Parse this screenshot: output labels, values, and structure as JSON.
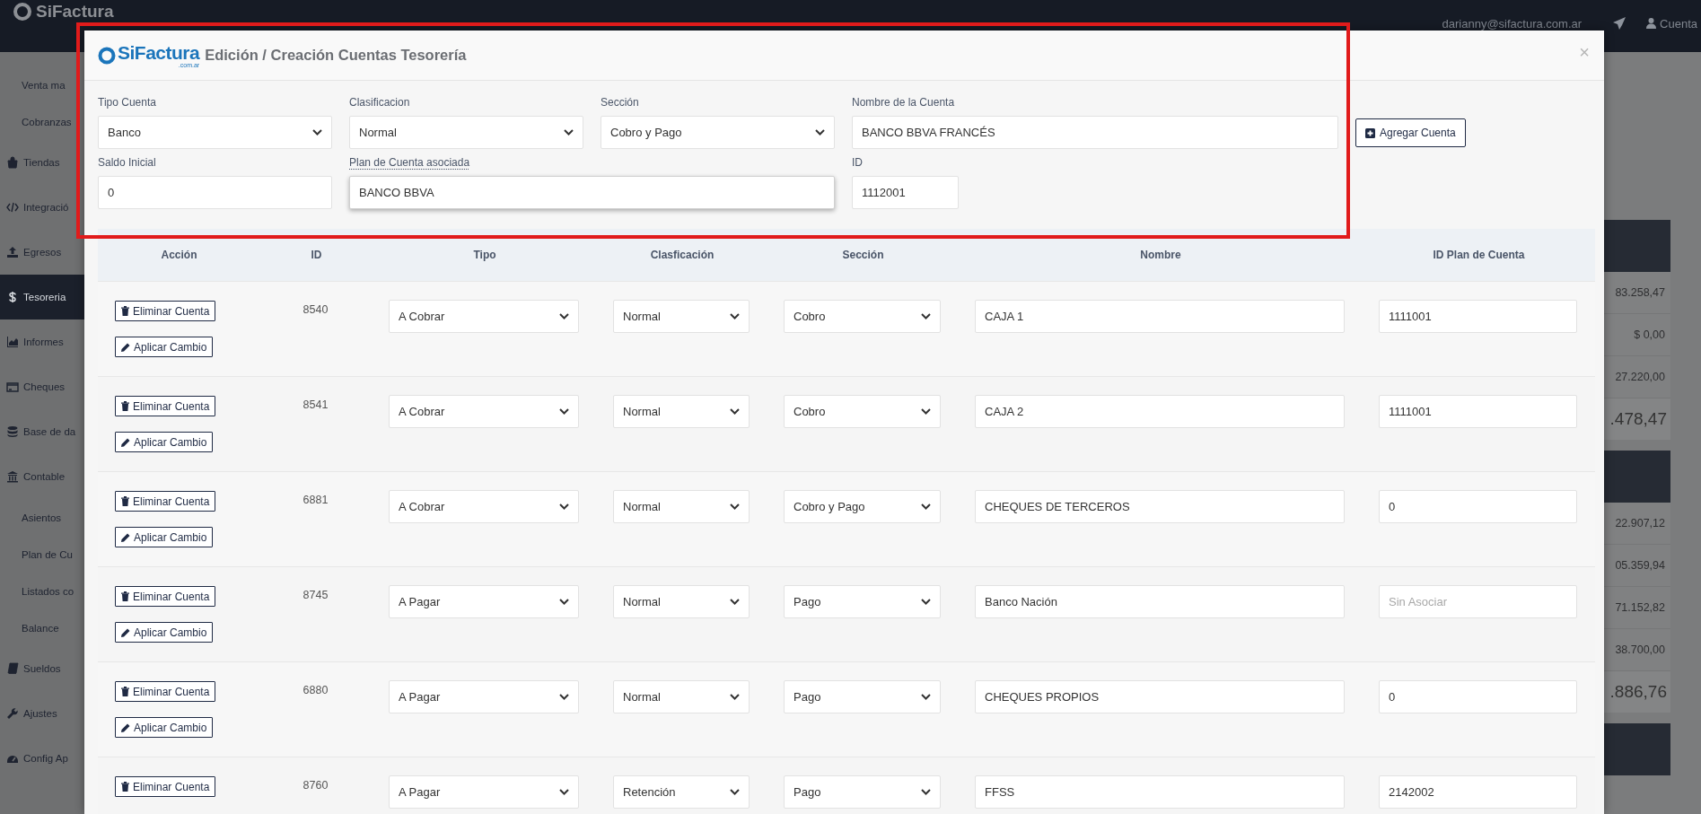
{
  "top_bar": {
    "logo": "SiFactura",
    "user_email": "darianny@sifactura.com.ar",
    "account_label": "Cuenta"
  },
  "sidebar": {
    "items": [
      {
        "kind": "subitem",
        "label": "Venta ma",
        "selected": false
      },
      {
        "kind": "subitem",
        "label": "Cobranzas",
        "selected": false
      },
      {
        "kind": "section",
        "label": "Tiendas",
        "selected": false
      },
      {
        "kind": "section",
        "label": "Integració",
        "selected": false
      },
      {
        "kind": "section",
        "label": "Egresos",
        "selected": false
      },
      {
        "kind": "section",
        "label": "Tesoreria",
        "selected": true
      },
      {
        "kind": "section",
        "label": "Informes",
        "selected": false
      },
      {
        "kind": "section",
        "label": "Cheques",
        "selected": false
      },
      {
        "kind": "section",
        "label": "Base de da",
        "selected": false
      },
      {
        "kind": "section",
        "label": "Contable",
        "selected": false
      },
      {
        "kind": "subitem",
        "label": "Asientos",
        "selected": false
      },
      {
        "kind": "subitem",
        "label": "Plan de Cu",
        "selected": false
      },
      {
        "kind": "subitem",
        "label": "Listados co",
        "selected": false
      },
      {
        "kind": "subitem",
        "label": "Balance",
        "selected": false
      },
      {
        "kind": "section",
        "label": "Sueldos",
        "selected": false
      },
      {
        "kind": "section",
        "label": "Ajustes",
        "selected": false
      },
      {
        "kind": "section",
        "label": "Config Ap",
        "selected": false
      }
    ]
  },
  "background_panel": {
    "items": [
      {
        "kind": "header"
      },
      {
        "kind": "amount",
        "text": "83.258,47"
      },
      {
        "kind": "amount",
        "text": "$ 0,00"
      },
      {
        "kind": "amount",
        "text": "27.220,00"
      },
      {
        "kind": "total",
        "text": ".478,47"
      },
      {
        "kind": "header"
      },
      {
        "kind": "amount",
        "text": "22.907,12"
      },
      {
        "kind": "amount",
        "text": "05.359,94"
      },
      {
        "kind": "amount",
        "text": "71.152,82"
      },
      {
        "kind": "amount",
        "text": "38.700,00"
      },
      {
        "kind": "total",
        "text": ".886,76"
      },
      {
        "kind": "header"
      }
    ]
  },
  "modal": {
    "logo": "SiFactura",
    "logo_suffix": ".com.ar",
    "title": "Edición / Creación Cuentas Tesorería",
    "close": "×",
    "form": {
      "rows": [
        [
          {
            "kind": "select",
            "label": "Tipo Cuenta",
            "value": "Banco",
            "label_dotted": false,
            "focused": false
          },
          {
            "kind": "select",
            "label": "Clasificacion",
            "value": "Normal",
            "label_dotted": false,
            "focused": false
          },
          {
            "kind": "select",
            "label": "Sección",
            "value": "Cobro y Pago",
            "label_dotted": false,
            "focused": false
          },
          {
            "kind": "input",
            "label": "Nombre de la Cuenta",
            "value": "BANCO BBVA FRANCÉS",
            "label_dotted": false,
            "focused": false
          }
        ],
        [
          {
            "kind": "input",
            "label": "Saldo Inicial",
            "value": "0",
            "label_dotted": false,
            "focused": false
          },
          {
            "kind": "input",
            "label": "Plan de Cuenta asociada",
            "value": "BANCO BBVA",
            "label_dotted": true,
            "focused": true
          },
          "",
          {
            "kind": "input",
            "label": "ID",
            "value": "1112001",
            "label_dotted": false,
            "focused": false
          }
        ]
      ],
      "add_button": "Agregar Cuenta"
    },
    "table": {
      "columns": [
        "Acción",
        "ID",
        "Tipo",
        "Clasficación",
        "Sección",
        "Nombre",
        "ID Plan de Cuenta"
      ],
      "rows": [
        {
          "actions": [
            {
              "kind": "delete",
              "label": "Eliminar Cuenta"
            },
            {
              "kind": "apply",
              "label": "Aplicar Cambio"
            }
          ],
          "id": "8540",
          "tipo": "A Cobrar",
          "clasificacion": "Normal",
          "seccion": "Cobro",
          "nombre": "CAJA 1",
          "id_plan": "1111001"
        },
        {
          "actions": [
            {
              "kind": "delete",
              "label": "Eliminar Cuenta"
            },
            {
              "kind": "apply",
              "label": "Aplicar Cambio"
            }
          ],
          "id": "8541",
          "tipo": "A Cobrar",
          "clasificacion": "Normal",
          "seccion": "Cobro",
          "nombre": "CAJA 2",
          "id_plan": "1111001"
        },
        {
          "actions": [
            {
              "kind": "delete",
              "label": "Eliminar Cuenta"
            },
            {
              "kind": "apply",
              "label": "Aplicar Cambio"
            }
          ],
          "id": "6881",
          "tipo": "A Cobrar",
          "clasificacion": "Normal",
          "seccion": "Cobro y Pago",
          "nombre": "CHEQUES DE TERCEROS",
          "id_plan": "0"
        },
        {
          "actions": [
            {
              "kind": "delete",
              "label": "Eliminar Cuenta"
            },
            {
              "kind": "apply",
              "label": "Aplicar Cambio"
            }
          ],
          "id": "8745",
          "tipo": "A Pagar",
          "clasificacion": "Normal",
          "seccion": "Pago",
          "nombre": "Banco Nación",
          "id_plan_placeholder": "Sin Asociar"
        },
        {
          "actions": [
            {
              "kind": "delete",
              "label": "Eliminar Cuenta"
            },
            {
              "kind": "apply",
              "label": "Aplicar Cambio"
            }
          ],
          "id": "6880",
          "tipo": "A Pagar",
          "clasificacion": "Normal",
          "seccion": "Pago",
          "nombre": "CHEQUES PROPIOS",
          "id_plan": "0"
        },
        {
          "actions": [
            {
              "kind": "delete",
              "label": "Eliminar Cuenta"
            }
          ],
          "id": "8760",
          "tipo": "A Pagar",
          "clasificacion": "Retención",
          "seccion": "Pago",
          "nombre": "FFSS",
          "id_plan": "2142002"
        }
      ]
    }
  }
}
